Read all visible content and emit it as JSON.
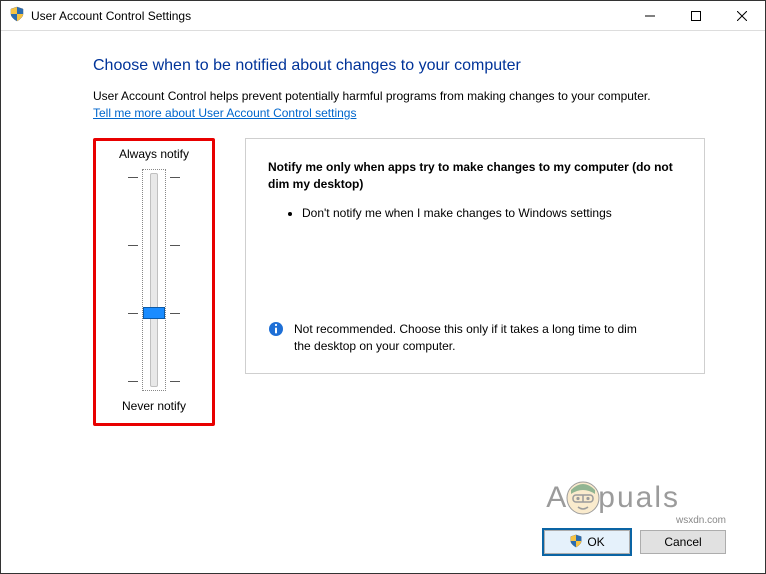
{
  "window": {
    "title": "User Account Control Settings"
  },
  "header": {
    "heading": "Choose when to be notified about changes to your computer",
    "subtext": "User Account Control helps prevent potentially harmful programs from making changes to your computer.",
    "link": "Tell me more about User Account Control settings"
  },
  "slider": {
    "top_label": "Always notify",
    "bottom_label": "Never notify",
    "levels": 4,
    "selected_index": 2
  },
  "description": {
    "title": "Notify me only when apps try to make changes to my computer (do not dim my desktop)",
    "bullet1": "Don't notify me when I make changes to Windows settings",
    "info": "Not recommended. Choose this only if it takes a long time to dim the desktop on your computer."
  },
  "buttons": {
    "ok": "OK",
    "cancel": "Cancel"
  },
  "watermark": {
    "left": "A",
    "right": "puals",
    "wsxdn": "wsxdn.com"
  }
}
